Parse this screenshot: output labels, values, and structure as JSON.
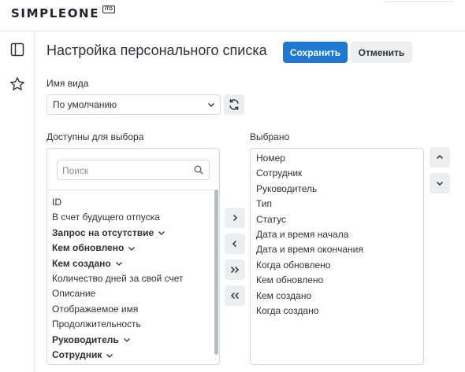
{
  "header": {
    "logo_text": "SIMPLEONE",
    "logo_badge": "ITO"
  },
  "sidebar": {
    "icons": [
      "sidebar-panel-icon",
      "star-icon"
    ]
  },
  "page": {
    "title": "Настройка персонального списка",
    "save_label": "Сохранить",
    "cancel_label": "Отменить"
  },
  "view": {
    "label": "Имя вида",
    "selected": "По умолчанию"
  },
  "available": {
    "label": "Доступны для выбора",
    "search_placeholder": "Поиск",
    "items": [
      {
        "label": "ID",
        "expandable": false
      },
      {
        "label": "В счет будущего отпуска",
        "expandable": false
      },
      {
        "label": "Запрос на отсутствие",
        "expandable": true
      },
      {
        "label": "Кем обновлено",
        "expandable": true
      },
      {
        "label": "Кем создано",
        "expandable": true
      },
      {
        "label": "Количество дней за свой счет",
        "expandable": false
      },
      {
        "label": "Описание",
        "expandable": false
      },
      {
        "label": "Отображаемое имя",
        "expandable": false
      },
      {
        "label": "Продолжительность",
        "expandable": false
      },
      {
        "label": "Руководитель",
        "expandable": true
      },
      {
        "label": "Сотрудник",
        "expandable": true
      }
    ]
  },
  "selected": {
    "label": "Выбрано",
    "items": [
      "Номер",
      "Сотрудник",
      "Руководитель",
      "Тип",
      "Статус",
      "Дата и время начала",
      "Дата и время окончания",
      "Когда обновлено",
      "Кем обновлено",
      "Кем создано",
      "Когда создано"
    ]
  },
  "transfer_buttons": [
    "chevron-right-icon",
    "chevron-left-icon",
    "double-chevron-right-icon",
    "double-chevron-left-icon"
  ],
  "order_buttons": [
    "chevron-up-icon",
    "chevron-down-icon"
  ],
  "colors": {
    "primary": "#1f78d1",
    "secondary_bg": "#eceef0",
    "border": "#d6d9dc",
    "text": "#2e3238"
  }
}
